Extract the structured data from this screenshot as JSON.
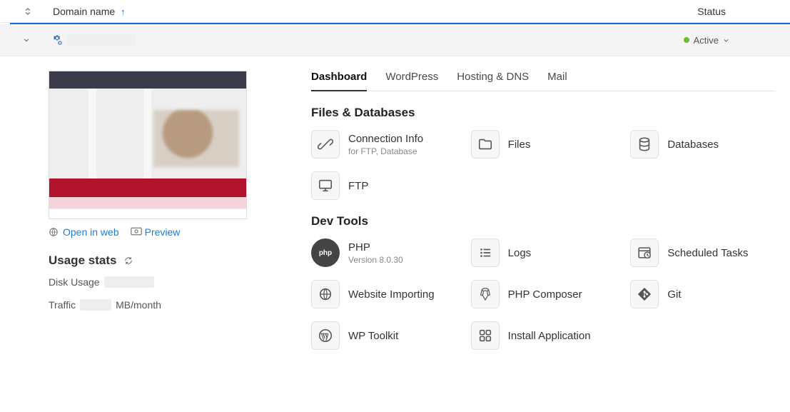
{
  "header": {
    "domain_col": "Domain name",
    "status_col": "Status"
  },
  "domain": {
    "status": "Active"
  },
  "preview_links": {
    "open_in_web": "Open in web",
    "preview": "Preview"
  },
  "usage": {
    "title": "Usage stats",
    "disk_label": "Disk Usage",
    "disk_unit": "",
    "traffic_label": "Traffic",
    "traffic_unit": "MB/month"
  },
  "tabs": {
    "dashboard": "Dashboard",
    "wordpress": "WordPress",
    "hosting": "Hosting & DNS",
    "mail": "Mail"
  },
  "sections": {
    "files_db": "Files & Databases",
    "dev_tools": "Dev Tools"
  },
  "cards": {
    "conn_info": {
      "label": "Connection Info",
      "sub": "for FTP, Database"
    },
    "files": {
      "label": "Files"
    },
    "databases": {
      "label": "Databases"
    },
    "ftp": {
      "label": "FTP"
    },
    "php": {
      "label": "PHP",
      "sub": "Version 8.0.30"
    },
    "logs": {
      "label": "Logs"
    },
    "scheduled": {
      "label": "Scheduled Tasks"
    },
    "importing": {
      "label": "Website Importing"
    },
    "composer": {
      "label": "PHP Composer"
    },
    "git": {
      "label": "Git"
    },
    "wp_toolkit": {
      "label": "WP Toolkit"
    },
    "install_app": {
      "label": "Install Application"
    }
  }
}
